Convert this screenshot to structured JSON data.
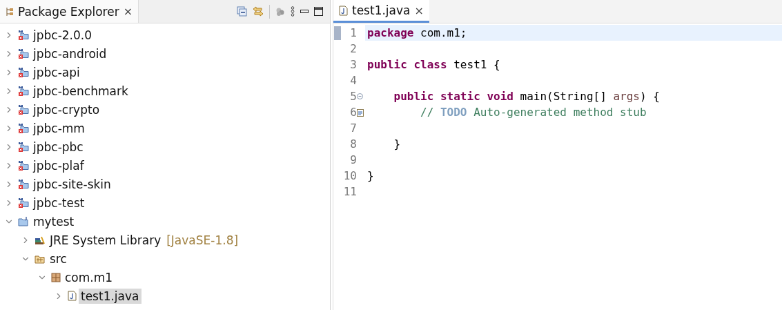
{
  "explorer": {
    "title": "Package Explorer",
    "close": "×",
    "items": [
      {
        "label": "jpbc-2.0.0",
        "kind": "project",
        "expanded": false,
        "selected": false
      },
      {
        "label": "jpbc-android",
        "kind": "project",
        "expanded": false,
        "selected": false
      },
      {
        "label": "jpbc-api",
        "kind": "project",
        "expanded": false,
        "selected": false
      },
      {
        "label": "jpbc-benchmark",
        "kind": "project",
        "expanded": false,
        "selected": false
      },
      {
        "label": "jpbc-crypto",
        "kind": "project",
        "expanded": false,
        "selected": false
      },
      {
        "label": "jpbc-mm",
        "kind": "project",
        "expanded": false,
        "selected": false
      },
      {
        "label": "jpbc-pbc",
        "kind": "project",
        "expanded": false,
        "selected": false
      },
      {
        "label": "jpbc-plaf",
        "kind": "project",
        "expanded": false,
        "selected": false
      },
      {
        "label": "jpbc-site-skin",
        "kind": "project",
        "expanded": false,
        "selected": false
      },
      {
        "label": "jpbc-test",
        "kind": "project",
        "expanded": false,
        "selected": false
      },
      {
        "label": "mytest",
        "kind": "java-project",
        "expanded": true,
        "selected": false,
        "children": [
          {
            "label": "JRE System Library",
            "decoration": "[JavaSE-1.8]",
            "kind": "library",
            "expanded": false,
            "selected": false
          },
          {
            "label": "src",
            "kind": "source-folder",
            "expanded": true,
            "selected": false,
            "children": [
              {
                "label": "com.m1",
                "kind": "package",
                "expanded": true,
                "selected": false,
                "children": [
                  {
                    "label": "test1.java",
                    "kind": "java-file",
                    "expanded": false,
                    "selected": true
                  }
                ]
              }
            ]
          }
        ]
      }
    ]
  },
  "editor": {
    "tab": {
      "label": "test1.java",
      "close": "×",
      "selected": true
    },
    "lines": [
      {
        "number": "1",
        "current": true,
        "fold": false,
        "task": false,
        "tokens": [
          {
            "kind": "keyword",
            "text": "package"
          },
          {
            "kind": "plain",
            "text": " com.m1;"
          }
        ]
      },
      {
        "number": "2",
        "current": false,
        "fold": false,
        "task": false
      },
      {
        "number": "3",
        "current": false,
        "fold": false,
        "task": false,
        "tokens": [
          {
            "kind": "keyword",
            "text": "public class"
          },
          {
            "kind": "plain",
            "text": " test1 {"
          }
        ]
      },
      {
        "number": "4",
        "current": false,
        "fold": false,
        "task": false
      },
      {
        "number": "5",
        "current": false,
        "fold": true,
        "task": false,
        "tokens": [
          {
            "kind": "keyword",
            "text": "    public static void"
          },
          {
            "kind": "plain",
            "text": " main(String[] "
          },
          {
            "kind": "param",
            "text": "args"
          },
          {
            "kind": "plain",
            "text": ") {"
          }
        ]
      },
      {
        "number": "6",
        "current": false,
        "fold": false,
        "task": true,
        "tokens": [
          {
            "kind": "comment",
            "text": "        // "
          },
          {
            "kind": "todo",
            "text": "TODO"
          },
          {
            "kind": "comment",
            "text": " Auto-generated method stub"
          }
        ]
      },
      {
        "number": "7",
        "current": false,
        "fold": false,
        "task": false
      },
      {
        "number": "8",
        "current": false,
        "fold": false,
        "task": false,
        "tokens": [
          {
            "kind": "plain",
            "text": "    }"
          }
        ]
      },
      {
        "number": "9",
        "current": false,
        "fold": false,
        "task": false
      },
      {
        "number": "10",
        "current": false,
        "fold": false,
        "task": false,
        "tokens": [
          {
            "kind": "plain",
            "text": "}"
          }
        ]
      },
      {
        "number": "11",
        "current": false,
        "fold": false,
        "task": false
      }
    ]
  }
}
